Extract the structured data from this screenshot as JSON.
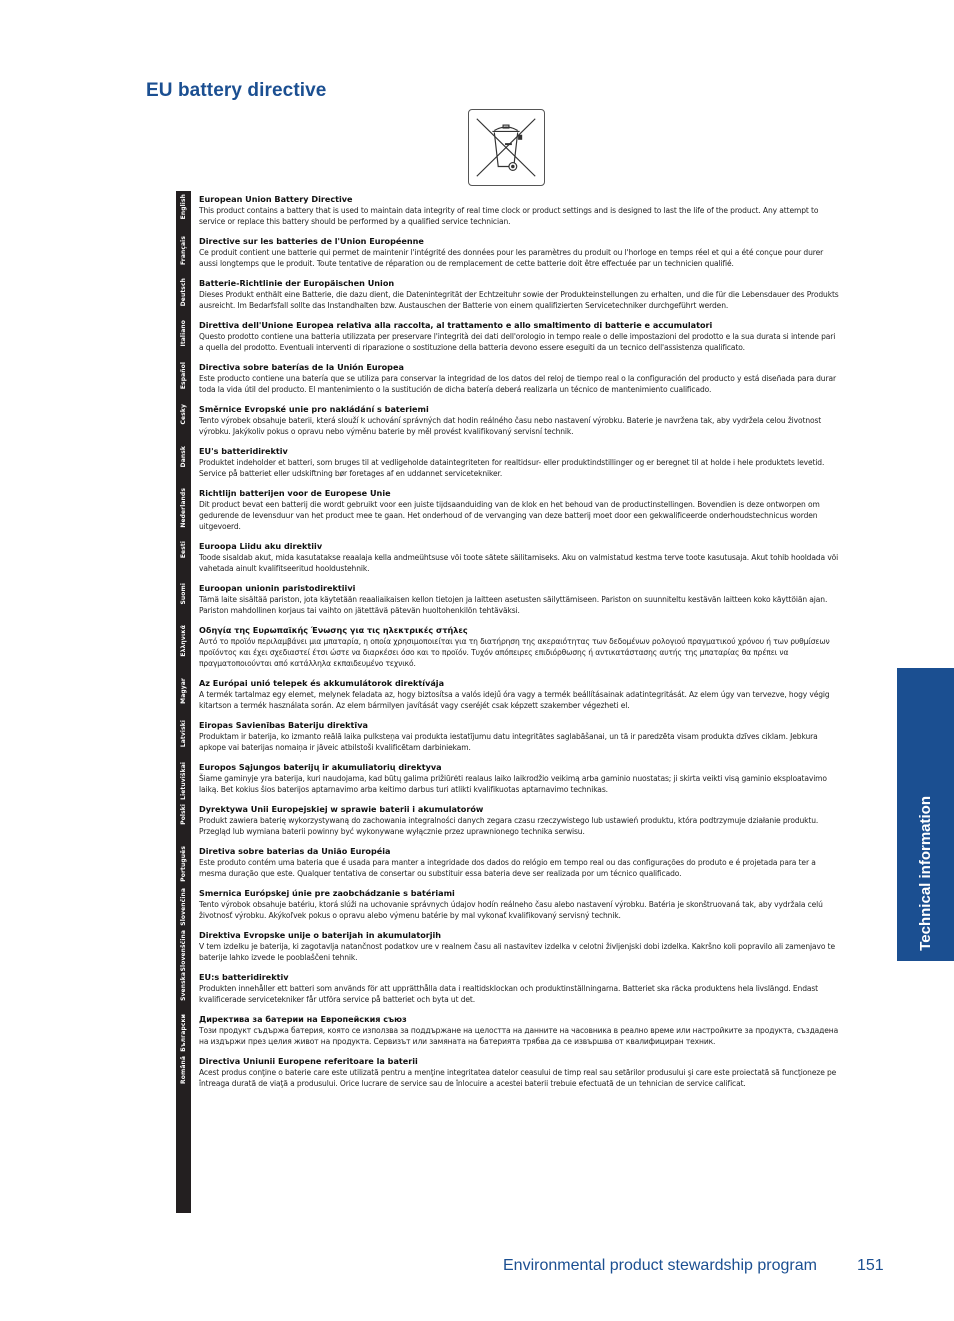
{
  "page": {
    "title": "EU battery directive",
    "symbol_icon": "crossed-out-wheelie-bin-icon",
    "side_tab": "Technical information",
    "footer": {
      "section": "Environmental product stewardship program",
      "page_number": "151"
    },
    "colors": {
      "brand_blue": "#1b4f91",
      "strip_dark": "#231f20"
    }
  },
  "sections": [
    {
      "lang": "English",
      "heading": "European Union Battery Directive",
      "text": "This product contains a battery that is used to maintain data integrity of real time clock or product settings and is designed to last the life of the product.  Any attempt to service or replace this battery should be performed by a qualified service technician."
    },
    {
      "lang": "Français",
      "heading": "Directive sur les batteries de l'Union Européenne",
      "text": "Ce produit contient une batterie qui permet de maintenir l'intégrité des données pour les paramètres du produit ou l'horloge en temps réel et qui a été conçue pour durer aussi longtemps que le produit. Toute tentative de réparation ou de remplacement de cette batterie doit être effectuée par un technicien qualifié."
    },
    {
      "lang": "Deutsch",
      "heading": "Batterie-Richtlinie der Europäischen Union",
      "text": "Dieses Produkt enthält eine Batterie, die dazu dient, die Datenintegrität der Echtzeituhr sowie der Produkteinstellungen zu erhalten, und die für die Lebensdauer des Produkts ausreicht. Im Bedarfsfall sollte das Instandhalten bzw. Austauschen der Batterie von einem qualifizierten Servicetechniker durchgeführt werden."
    },
    {
      "lang": "Italiano",
      "heading": "Direttiva dell'Unione Europea relativa alla raccolta, al trattamento e allo smaltimento di batterie e accumulatori",
      "text": "Questo prodotto contiene una batteria utilizzata per preservare l'integrità dei dati dell'orologio in tempo reale o delle impostazioni del prodotto e la sua durata si intende pari a quella del prodotto. Eventuali interventi di riparazione o sostituzione della batteria devono essere eseguiti da un tecnico dell'assistenza qualificato."
    },
    {
      "lang": "Español",
      "heading": "Directiva sobre baterías de la Unión Europea",
      "text": "Este producto contiene una batería que se utiliza para conservar la integridad de los datos del reloj de tiempo real o la configuración del producto y está diseñada para durar toda la vida útil del producto. El mantenimiento o la sustitución de dicha batería deberá realizarla un técnico de mantenimiento cualificado."
    },
    {
      "lang": "Česky",
      "heading": "Směrnice Evropské unie pro nakládání s bateriemi",
      "text": "Tento výrobek obsahuje baterii, která slouží k uchování správných dat hodin reálného času nebo nastavení výrobku. Baterie je navržena tak, aby vydržela celou životnost výrobku. Jakýkoliv pokus o opravu nebo výměnu baterie by měl provést kvalifikovaný servisní technik."
    },
    {
      "lang": "Dansk",
      "heading": "EU's batteridirektiv",
      "text": "Produktet indeholder et batteri, som bruges til at vedligeholde dataintegriteten for realtidsur- eller produktindstillinger og er beregnet til at holde i hele produktets levetid. Service på batteriet eller udskiftning bør foretages af en uddannet servicetekniker."
    },
    {
      "lang": "Nederlands",
      "heading": "Richtlijn batterijen voor de Europese Unie",
      "text": "Dit product bevat een batterij die wordt gebruikt voor een juiste tijdsaanduiding van de klok en het behoud van de productinstellingen. Bovendien is deze ontworpen om gedurende de levensduur van het product mee te gaan. Het onderhoud of de vervanging van deze batterij moet door een gekwalificeerde onderhoudstechnicus worden uitgevoerd."
    },
    {
      "lang": "Eesti",
      "heading": "Euroopa Liidu aku direktiiv",
      "text": "Toode sisaldab akut, mida kasutatakse reaalaja kella andmeühtsuse või toote sätete säilitamiseks. Aku on valmistatud kestma terve toote kasutusaja. Akut tohib hooldada või vahetada ainult kvalifitseeritud hooldustehnik."
    },
    {
      "lang": "Suomi",
      "heading": "Euroopan unionin paristodirektiivi",
      "text": "Tämä laite sisältää pariston, jota käytetään reaaliaikaisen kellon tietojen ja laitteen asetusten säilyttämiseen. Pariston on suunniteltu kestävän laitteen koko käyttöiän ajan. Pariston mahdollinen korjaus tai vaihto on jätettävä pätevän huoltohenkilön tehtäväksi."
    },
    {
      "lang": "Ελληνικά",
      "heading": "Οδηγία της Ευρωπαϊκής Ένωσης για τις ηλεκτρικές στήλες",
      "text": "Αυτό το προϊόν περιλαμβάνει μια μπαταρία, η οποία χρησιμοποιείται για τη διατήρηση της ακεραιότητας των δεδομένων ρολογιού πραγματικού χρόνου ή των ρυθμίσεων προϊόντος και έχει σχεδιαστεί έτσι ώστε να διαρκέσει όσο και το προϊόν. Τυχόν απόπειρες επιδιόρθωσης ή αντικατάστασης αυτής της μπαταρίας θα πρέπει να πραγματοποιούνται από κατάλληλα εκπαιδευμένο τεχνικό."
    },
    {
      "lang": "Magyar",
      "heading": "Az Európai unió telepek és akkumulátorok direktívája",
      "text": "A termék tartalmaz egy elemet, melynek feladata az, hogy biztosítsa a valós idejű óra vagy a termék beállításainak adatintegritását. Az elem úgy van tervezve, hogy végig kitartson a termék használata során. Az elem bármilyen javítását vagy cseréjét csak képzett szakember végezheti el."
    },
    {
      "lang": "Latviski",
      "heading": "Eiropas Savienības Bateriju direktīva",
      "text": "Produktam ir baterija, ko izmanto reālā laika pulksteņa vai produkta iestatījumu datu integritātes saglabāšanai, un tā ir paredzēta visam produkta dzīves ciklam. Jebkura apkope vai baterijas nomaiņa ir jāveic atbilstoši kvalificētam darbiniekam."
    },
    {
      "lang": "Lietuviškai",
      "heading": "Europos Sąjungos baterijų ir akumuliatorių direktyva",
      "text": "Šiame gaminyje yra baterija, kuri naudojama, kad būtų galima prižiūrėti realaus laiko laikrodžio veikimą arba gaminio nuostatas; ji skirta veikti visą gaminio eksploatavimo laiką. Bet kokius šios baterijos aptarnavimo arba keitimo darbus turi atlikti kvalifikuotas aptarnavimo technikas."
    },
    {
      "lang": "Polski",
      "heading": "Dyrektywa Unii Europejskiej w sprawie baterii i akumulatorów",
      "text": "Produkt zawiera baterię wykorzystywaną do zachowania integralności danych zegara czasu rzeczywistego lub ustawień produktu, która podtrzymuje działanie produktu. Przegląd lub wymiana baterii powinny być wykonywane wyłącznie przez uprawnionego technika serwisu."
    },
    {
      "lang": "Português",
      "heading": "Diretiva sobre baterias da União Européia",
      "text": "Este produto contém uma bateria que é usada para manter a integridade dos dados do relógio em tempo real ou das configurações do produto e é projetada para ter a mesma duração que este. Qualquer tentativa de consertar ou substituir essa bateria deve ser realizada por um técnico qualificado."
    },
    {
      "lang": "Slovenčina",
      "heading": "Smernica Európskej únie pre zaobchádzanie s batériami",
      "text": "Tento výrobok obsahuje batériu, ktorá slúži na uchovanie správnych údajov hodín reálneho času alebo nastavení výrobku. Batéria je skonštruovaná tak, aby vydržala celú životnosť výrobku. Akýkoľvek pokus o opravu alebo výmenu batérie by mal vykonať kvalifikovaný servisný technik."
    },
    {
      "lang": "Slovenščina",
      "heading": "Direktiva Evropske unije o baterijah in akumulatorjih",
      "text": "V tem izdelku je baterija, ki zagotavlja natančnost podatkov ure v realnem času ali nastavitev izdelka v celotni življenjski dobi izdelka. Kakršno koli popravilo ali zamenjavo te baterije lahko izvede le pooblaščeni tehnik."
    },
    {
      "lang": "Svenska",
      "heading": "EU:s batteridirektiv",
      "text": "Produkten innehåller ett batteri som används för att upprätthålla data i realtidsklockan och produktinställningarna. Batteriet ska räcka produktens hela livslängd. Endast kvalificerade servicetekniker får utföra service på batteriet och byta ut det."
    },
    {
      "lang": "Български",
      "heading": "Директива за батерии на Европейския съюз",
      "text": "Този продукт съдържа батерия, която се използва за поддържане на целостта на данните на часовника в реално време или настройките за продукта, създадена на издържи през целия живот на продукта. Сервизът или замяната на батерията трябва да се извършва от квалифициран техник."
    },
    {
      "lang": "Română",
      "heading": "Directiva Uniunii Europene referitoare la baterii",
      "text": "Acest produs conţine o baterie care este utilizată pentru a menţine integritatea datelor ceasului de timp real sau setărilor produsului şi care este proiectată să funcţioneze pe întreaga durată de viaţă a produsului. Orice lucrare de service sau de înlocuire a acestei baterii trebuie efectuată de un tehnician de service calificat."
    }
  ]
}
